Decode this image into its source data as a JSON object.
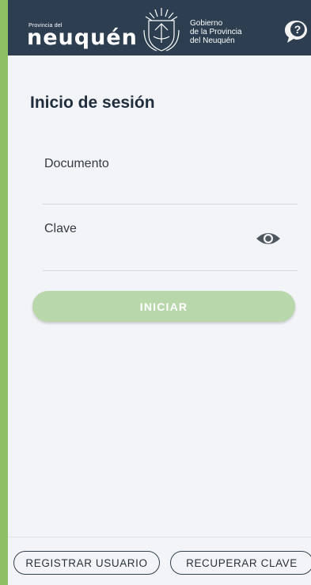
{
  "header": {
    "province_small": "Provincia del",
    "province_name": "neuquén",
    "gov_line1": "Gobierno",
    "gov_line2": "de la Provincia",
    "gov_line3": "del Neuquén",
    "help_icon": "help-question-bubble-icon"
  },
  "login": {
    "title": "Inicio de sesión",
    "document_label": "Documento",
    "document_value": "",
    "password_label": "Clave",
    "password_value": "",
    "eye_icon": "eye-visibility-icon",
    "submit_label": "INICIAR"
  },
  "footer": {
    "register_label": "REGISTRAR USUARIO",
    "recover_label": "RECUPERAR CLAVE"
  },
  "colors": {
    "header_bg": "#2c3e50",
    "page_bg": "#f3f4f8",
    "side_accent": "#8cc063",
    "button_disabled": "#b8d8ac"
  }
}
